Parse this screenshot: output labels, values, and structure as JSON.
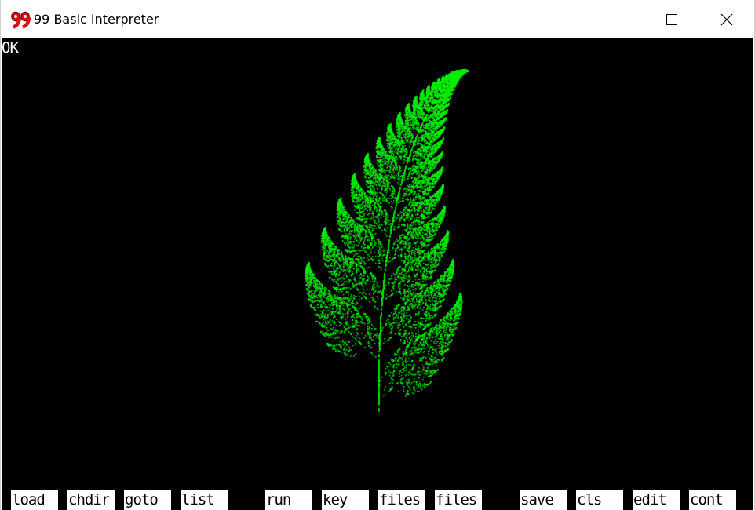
{
  "window": {
    "title": "99 Basic Interpreter",
    "icon_name": "99-app-icon"
  },
  "screen": {
    "status_text": "OK",
    "background": "#000000",
    "fern_color": "#00ee00"
  },
  "function_keys": [
    {
      "label": "load"
    },
    {
      "label": "chdir"
    },
    {
      "label": "goto"
    },
    {
      "label": "list"
    },
    {
      "label": "run"
    },
    {
      "label": "key"
    },
    {
      "label": "files"
    },
    {
      "label": "files"
    },
    {
      "label": "save"
    },
    {
      "label": "cls"
    },
    {
      "label": "edit"
    },
    {
      "label": "cont"
    }
  ]
}
